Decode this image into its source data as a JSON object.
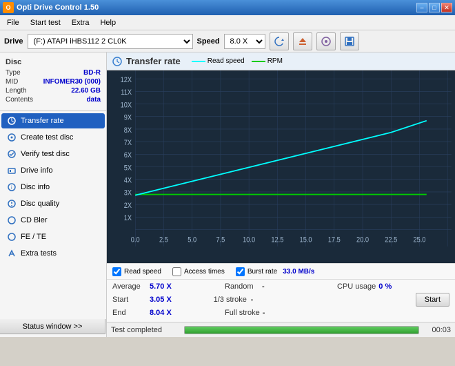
{
  "titleBar": {
    "title": "Opti Drive Control 1.50",
    "icon": "O",
    "minBtn": "–",
    "maxBtn": "□",
    "closeBtn": "✕"
  },
  "menuBar": {
    "items": [
      "File",
      "Start test",
      "Extra",
      "Help"
    ]
  },
  "driveBar": {
    "driveLabel": "Drive",
    "driveValue": "(F:)  ATAPI iHBS112  2 CL0K",
    "speedLabel": "Speed",
    "speedValue": "8.0 X"
  },
  "disc": {
    "title": "Disc",
    "fields": [
      {
        "key": "Type",
        "val": "BD-R"
      },
      {
        "key": "MID",
        "val": "INFOMER30 (000)"
      },
      {
        "key": "Length",
        "val": "22.60 GB"
      },
      {
        "key": "Contents",
        "val": "data"
      }
    ]
  },
  "sidebar": {
    "items": [
      {
        "label": "Transfer rate",
        "active": true
      },
      {
        "label": "Create test disc",
        "active": false
      },
      {
        "label": "Verify test disc",
        "active": false
      },
      {
        "label": "Drive info",
        "active": false
      },
      {
        "label": "Disc info",
        "active": false
      },
      {
        "label": "Disc quality",
        "active": false
      },
      {
        "label": "CD Bler",
        "active": false
      },
      {
        "label": "FE / TE",
        "active": false
      },
      {
        "label": "Extra tests",
        "active": false
      }
    ]
  },
  "chart": {
    "title": "Transfer rate",
    "legendReadSpeed": "Read speed",
    "legendRPM": "RPM",
    "yLabels": [
      "12X",
      "11X",
      "10X",
      "9X",
      "8X",
      "7X",
      "6X",
      "5X",
      "4X",
      "3X",
      "2X",
      "1X"
    ],
    "xLabels": [
      "0.0",
      "2.5",
      "5.0",
      "7.5",
      "10.0",
      "12.5",
      "15.0",
      "17.5",
      "20.0",
      "22.5",
      "25.0"
    ],
    "readSpeedChecked": true,
    "accessTimesChecked": false,
    "burstRateChecked": true,
    "burstRateVal": "33.0 MB/s"
  },
  "stats": {
    "average": {
      "key": "Average",
      "val": "5.70 X"
    },
    "random": {
      "key": "Random",
      "val": "-"
    },
    "cpuUsage": {
      "key": "CPU usage",
      "val": "0 %"
    },
    "start": {
      "key": "Start",
      "val": "3.05 X"
    },
    "oneThirdStroke": {
      "key": "1/3 stroke",
      "val": "-"
    },
    "end": {
      "key": "End",
      "val": "8.04 X"
    },
    "fullStroke": {
      "key": "Full stroke",
      "val": "-"
    },
    "startBtn": "Start"
  },
  "statusBar": {
    "text": "Test completed",
    "progress": 100,
    "time": "00:03"
  },
  "statusWindowBtn": "Status window >>"
}
